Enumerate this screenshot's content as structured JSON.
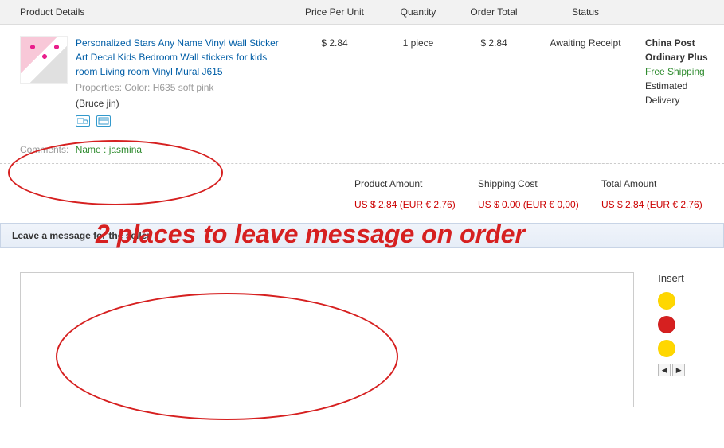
{
  "headers": {
    "product": "Product Details",
    "price": "Price Per Unit",
    "quantity": "Quantity",
    "total": "Order Total",
    "status": "Status"
  },
  "product": {
    "link": "Personalized Stars Any Name Vinyl Wall Sticker Art Decal Kids Bedroom Wall stickers for kids room Living room Vinyl Mural J615",
    "properties": "Properties: Color: H635 soft pink",
    "seller": "(Bruce jin)"
  },
  "order": {
    "price": "$ 2.84",
    "quantity": "1 piece",
    "total": "$ 2.84",
    "status": "Awaiting Receipt"
  },
  "shipping": {
    "method": "China Post Ordinary Plus",
    "free": "Free Shipping",
    "delivery": "Estimated Delivery"
  },
  "comments": {
    "label": "Comments:",
    "value": "Name : jasmina"
  },
  "summary": {
    "headers": {
      "product": "Product Amount",
      "shipping": "Shipping Cost",
      "total": "Total Amount"
    },
    "values": {
      "product": "US $ 2.84 (EUR € 2,76)",
      "shipping": "US $ 0.00 (EUR € 0,00)",
      "total": "US $ 2.84 (EUR € 2,76)"
    }
  },
  "message_section": {
    "title": "Leave a message for the seller",
    "emoji_title": "Insert"
  },
  "annotation": {
    "text": "2 places to leave message on order"
  }
}
